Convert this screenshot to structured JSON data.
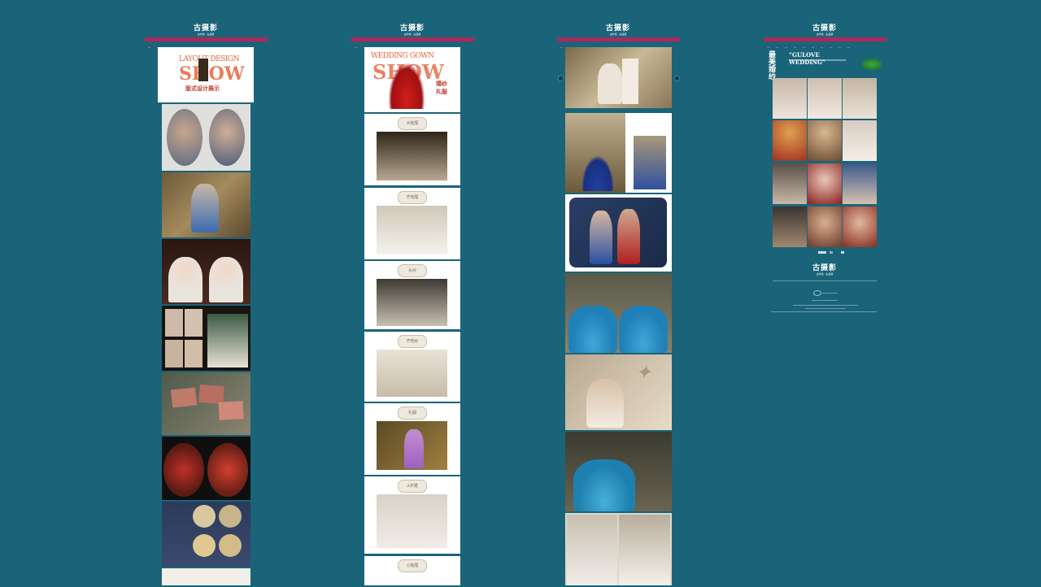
{
  "brand": {
    "logo": "古摄影",
    "sub": "古时尚 · 古品质"
  },
  "col1": {
    "hero_top": "LAYOUT DESIGN",
    "hero_big": "SHOW",
    "hero_cn": "版式设计展示"
  },
  "col2": {
    "hero_top": "WEDDING GOWN",
    "hero_big": "SHOW",
    "hero_cn1": "婚纱",
    "hero_cn2": "礼服",
    "cards": [
      {
        "label": "大拖尾"
      },
      {
        "label": "齐地尾"
      },
      {
        "label": "头纱"
      },
      {
        "label": "齐地纱"
      },
      {
        "label": "礼服"
      },
      {
        "label": "A字裙"
      },
      {
        "label": "小拖尾"
      }
    ]
  },
  "col4": {
    "title_cn1": "最美",
    "title_cn2": "婚纱",
    "title_en": "“GULOVE WEDDING”",
    "footer_logo": "古摄影",
    "footer_sub": "古时尚 · 古品质"
  },
  "colors": {
    "bg": "#1a6479",
    "nav": "#b0275d",
    "accent": "#c0392b"
  }
}
